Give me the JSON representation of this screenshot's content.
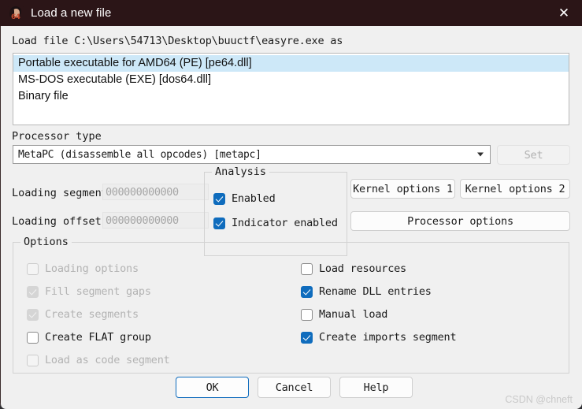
{
  "window": {
    "title": "Load a new file",
    "icon": "ida64-icon",
    "close_label": "✕"
  },
  "header": {
    "load_file_line": "Load file C:\\Users\\54713\\Desktop\\buuctf\\easyre.exe as"
  },
  "format_list": {
    "items": [
      {
        "label": "Portable executable for AMD64 (PE) [pe64.dll]",
        "selected": true
      },
      {
        "label": "MS-DOS executable (EXE) [dos64.dll]",
        "selected": false
      },
      {
        "label": "Binary file",
        "selected": false
      }
    ]
  },
  "processor": {
    "group_label": "Processor type",
    "selected": "MetaPC (disassemble all opcodes) [metapc]",
    "set_button": "Set"
  },
  "loading": {
    "segment_label": "Loading segment",
    "segment_value": "000000000000",
    "offset_label": "Loading offset",
    "offset_value": "000000000000"
  },
  "analysis": {
    "title": "Analysis",
    "items": [
      {
        "label": "Enabled",
        "checked": true
      },
      {
        "label": "Indicator enabled",
        "checked": true
      }
    ]
  },
  "side_buttons": {
    "kernel1": "Kernel options 1",
    "kernel2": "Kernel options 2",
    "processor_options": "Processor options"
  },
  "options": {
    "title": "Options",
    "left_column": [
      {
        "label": "Loading options",
        "checked": false,
        "enabled": false
      },
      {
        "label": "Fill segment gaps",
        "checked": true,
        "enabled": false
      },
      {
        "label": "Create segments",
        "checked": true,
        "enabled": false
      },
      {
        "label": "Create FLAT group",
        "checked": false,
        "enabled": true
      },
      {
        "label": "Load as code segment",
        "checked": false,
        "enabled": false
      }
    ],
    "right_column": [
      {
        "label": "Load resources",
        "checked": false,
        "enabled": true
      },
      {
        "label": "Rename DLL entries",
        "checked": true,
        "enabled": true
      },
      {
        "label": "Manual load",
        "checked": false,
        "enabled": true
      },
      {
        "label": "Create imports segment",
        "checked": true,
        "enabled": true
      }
    ]
  },
  "footer": {
    "ok": "OK",
    "cancel": "Cancel",
    "help": "Help"
  },
  "watermark": "CSDN @chneft",
  "colors": {
    "titlebar": "#2b1517",
    "accent": "#0f6cbd",
    "selection": "#cde8f8",
    "dialog_bg": "#f0f0f0"
  }
}
